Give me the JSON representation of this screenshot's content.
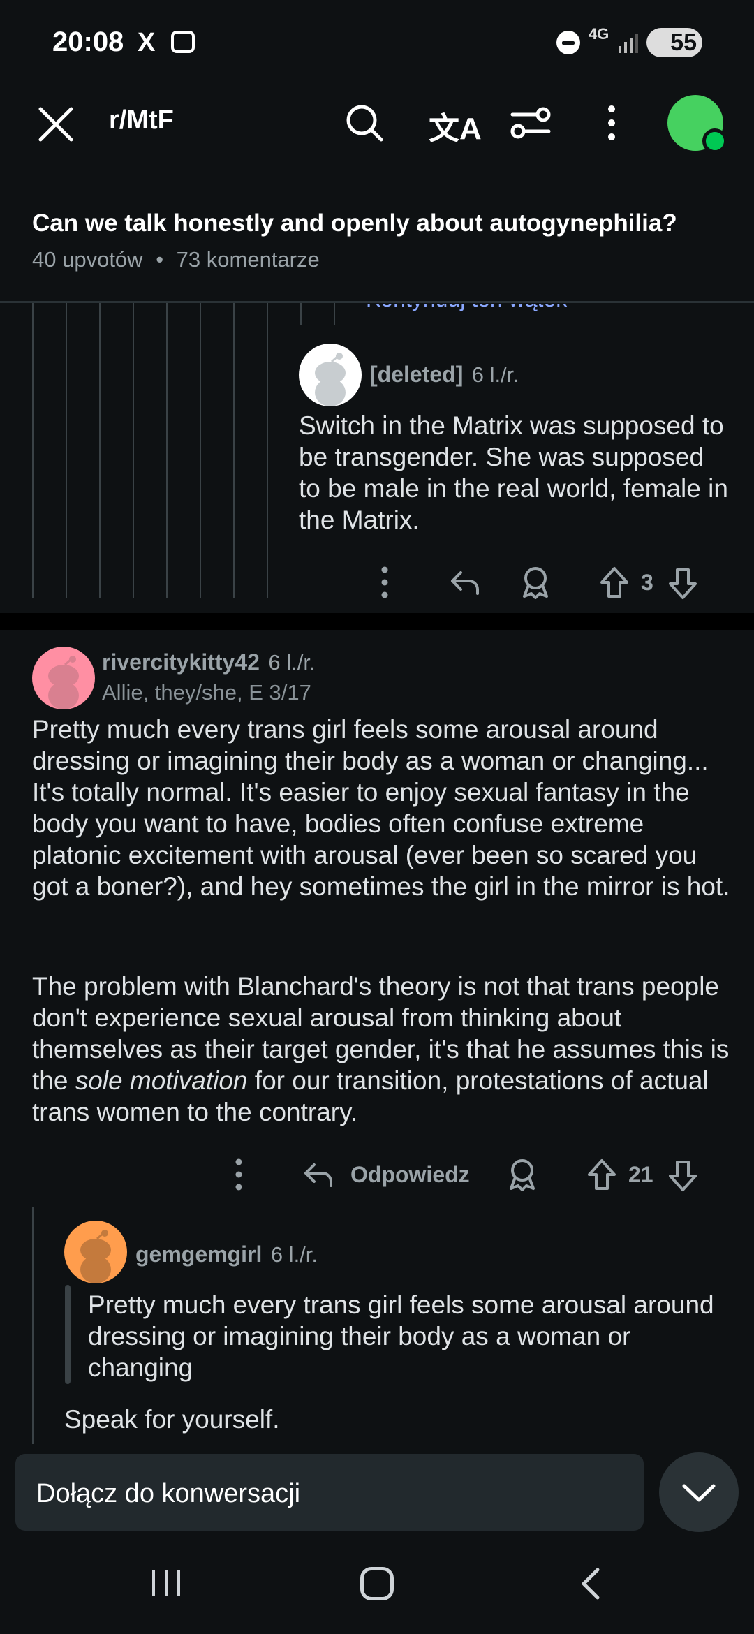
{
  "status": {
    "time": "20:08",
    "x_logo": "X",
    "network": "4G",
    "battery": "55"
  },
  "appbar": {
    "subreddit": "r/MtF",
    "translate_glyph": "文A"
  },
  "post": {
    "title": "Can we talk honestly and openly about autogynephilia?",
    "upvotes": "40 upvotów",
    "comments": "73 komentarze",
    "meta_sep": "•"
  },
  "thread": {
    "continue_text": "Kontynuuj ten wątek"
  },
  "comments": [
    {
      "user": "[deleted]",
      "age": "6 l./r.",
      "body": "Switch in the Matrix was supposed to be transgender. She was supposed to be male in the real world, female in the Matrix.",
      "votes": "3"
    },
    {
      "user": "rivercitykitty42",
      "age": "6 l./r.",
      "flair": "Allie, they/she, E 3/17",
      "body_p1": "Pretty much every trans girl feels some arousal around dressing or imagining their body as a woman or changing... It's totally normal. It's easier to enjoy sexual fantasy in the body you want to have, bodies often confuse extreme platonic excitement with arousal (ever been so scared you got a boner?), and hey sometimes the girl in the mirror is hot.",
      "body_p2_a": "The problem with Blanchard's theory is not that trans people don't experience sexual arousal from thinking about themselves as their target gender, it's that he assumes this is the ",
      "body_p2_em": "sole motivation",
      "body_p2_b": " for our transition, protestations of actual trans women to the contrary.",
      "reply_label": "Odpowiedz",
      "votes": "21"
    },
    {
      "user": "gemgemgirl",
      "age": "6 l./r.",
      "quote": "Pretty much every trans girl feels some arousal around dressing or imagining their body as a woman or changing",
      "body": "Speak for yourself."
    }
  ],
  "compose": {
    "placeholder": "Dołącz do konwersacji"
  },
  "colors": {
    "background": "#0e1113",
    "link": "#8aa8ff",
    "user_avatar": "#46d160",
    "pink_avatar": "#ff8fa3",
    "orange_avatar": "#ff9d4d"
  }
}
